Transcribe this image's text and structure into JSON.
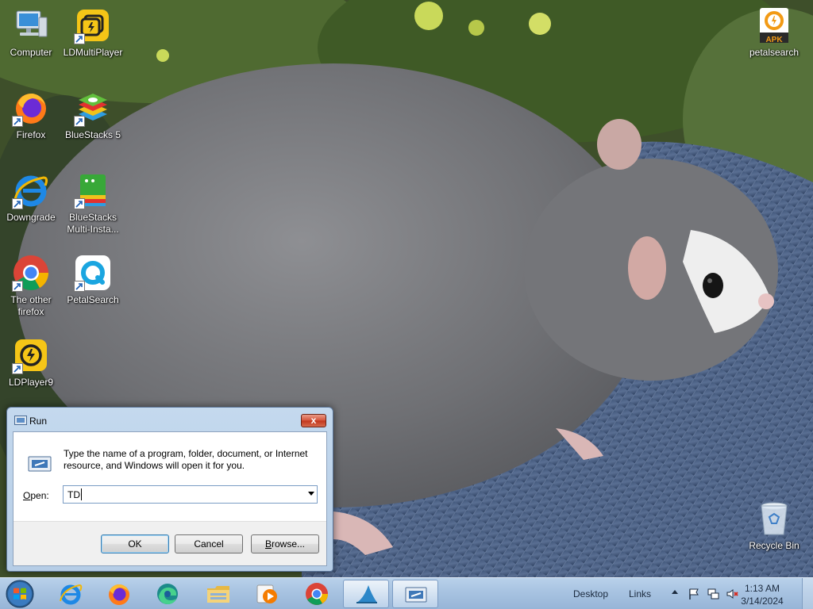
{
  "desktop": {
    "icons": [
      {
        "label": "Computer",
        "icon": "computer-icon"
      },
      {
        "label": "LDMultiPlayer",
        "icon": "ldmultiplayer-icon"
      },
      {
        "label": "Firefox",
        "icon": "firefox-icon"
      },
      {
        "label": "BlueStacks 5",
        "icon": "bluestacks-icon"
      },
      {
        "label": "Downgrade",
        "icon": "internet-explorer-icon"
      },
      {
        "label": "BlueStacks Multi-Insta...",
        "icon": "bluestacks-multi-instance-icon"
      },
      {
        "label": "The other firefox",
        "icon": "chrome-icon"
      },
      {
        "label": "PetalSearch",
        "icon": "petalsearch-icon"
      },
      {
        "label": "LDPlayer9",
        "icon": "ldplayer-icon"
      },
      {
        "label": "petalsearch",
        "icon": "apk-file-icon",
        "badge": "APK"
      },
      {
        "label": "Recycle Bin",
        "icon": "recycle-bin-icon"
      }
    ]
  },
  "run_dialog": {
    "title": "Run",
    "description": "Type the name of a program, folder, document, or Internet resource, and Windows will open it for you.",
    "open_label_accel": "O",
    "open_label_rest": "pen:",
    "input_value": "TD",
    "ok_label": "OK",
    "cancel_label": "Cancel",
    "browse_accel": "B",
    "browse_rest": "rowse...",
    "close_glyph": "x"
  },
  "taskbar": {
    "items": [
      {
        "name": "internet-explorer",
        "icon": "internet-explorer-icon",
        "active": false
      },
      {
        "name": "firefox",
        "icon": "firefox-icon",
        "active": false
      },
      {
        "name": "edge",
        "icon": "edge-icon",
        "active": false
      },
      {
        "name": "file-explorer",
        "icon": "folder-icon",
        "active": false
      },
      {
        "name": "media-player",
        "icon": "media-player-icon",
        "active": false
      },
      {
        "name": "chrome",
        "icon": "chrome-icon",
        "active": false
      },
      {
        "name": "shark-app",
        "icon": "shark-fin-icon",
        "active": true
      },
      {
        "name": "run",
        "icon": "run-icon",
        "active": true
      }
    ],
    "toolbar_desktop": "Desktop",
    "toolbar_links": "Links",
    "clock_time": "1:13 AM",
    "clock_date": "3/14/2024"
  },
  "colors": {
    "taskbar": "#a9c4e2",
    "dialog_frame": "#b6cde6",
    "close_button": "#c1361c"
  }
}
